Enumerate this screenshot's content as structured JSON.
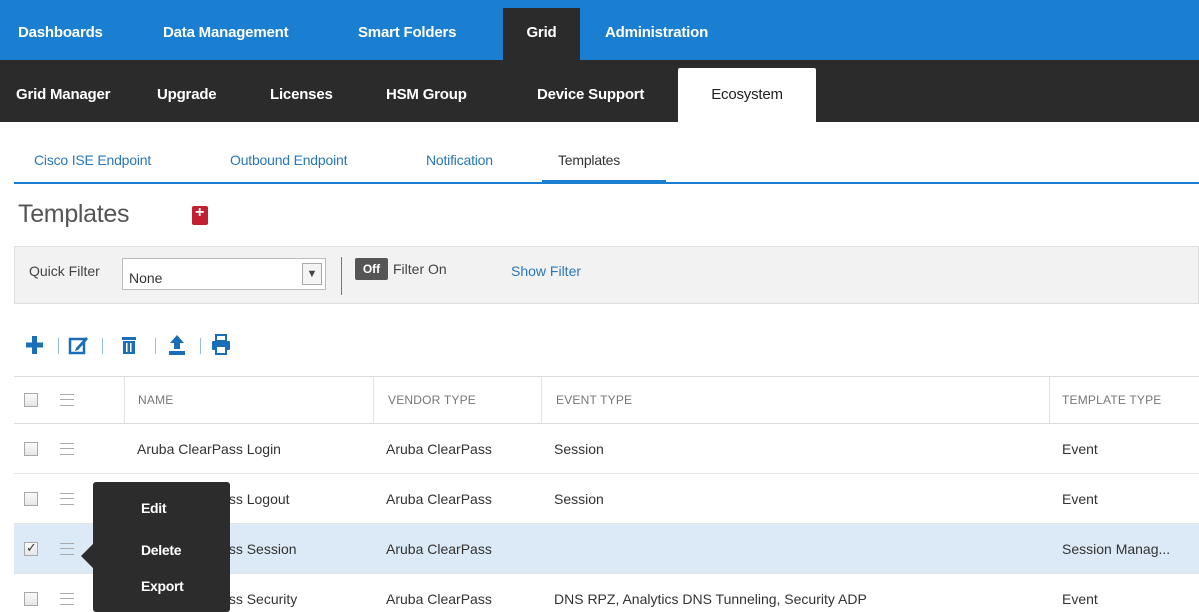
{
  "top_nav": {
    "items": [
      "Dashboards",
      "Data Management",
      "Smart Folders",
      "Grid",
      "Administration"
    ],
    "active": "Grid"
  },
  "sub_nav": {
    "items": [
      "Grid Manager",
      "Upgrade",
      "Licenses",
      "HSM Group",
      "Device Support",
      "Ecosystem"
    ],
    "active": "Ecosystem"
  },
  "tabs": {
    "items": [
      "Cisco ISE Endpoint",
      "Outbound Endpoint",
      "Notification",
      "Templates"
    ],
    "active": "Templates"
  },
  "page": {
    "title": "Templates"
  },
  "filter_bar": {
    "quick_filter_label": "Quick Filter",
    "quick_filter_value": "None",
    "toggle_label": "Off",
    "filter_on_label": "Filter On",
    "show_filter_label": "Show Filter"
  },
  "toolbar": {
    "icons": [
      "add-icon",
      "edit-icon",
      "delete-icon",
      "export-icon",
      "print-icon"
    ]
  },
  "table": {
    "columns": [
      "NAME",
      "VENDOR TYPE",
      "EVENT TYPE",
      "TEMPLATE TYPE"
    ],
    "rows": [
      {
        "name": "Aruba ClearPass Login",
        "vendor": "Aruba ClearPass",
        "event": "Session",
        "template": "Event",
        "checked": false
      },
      {
        "name": "Aruba ClearPass Logout",
        "vendor": "Aruba ClearPass",
        "event": "Session",
        "template": "Event",
        "checked": false
      },
      {
        "name": "Aruba ClearPass Session",
        "vendor": "Aruba ClearPass",
        "event": "",
        "template": "Session Manag...",
        "checked": true
      },
      {
        "name": "Aruba ClearPass Security",
        "vendor": "Aruba ClearPass",
        "event": "DNS RPZ, Analytics DNS Tunneling, Security ADP",
        "template": "Event",
        "checked": false
      }
    ]
  },
  "context_menu": {
    "items": [
      "Edit",
      "Delete",
      "Export"
    ]
  },
  "colors": {
    "top_nav_bg": "#1a7fd0",
    "sub_nav_bg": "#2b2b2b",
    "link": "#2a77b8",
    "selected_row": "#dbeaf6",
    "bookmark": "#c21f32"
  }
}
